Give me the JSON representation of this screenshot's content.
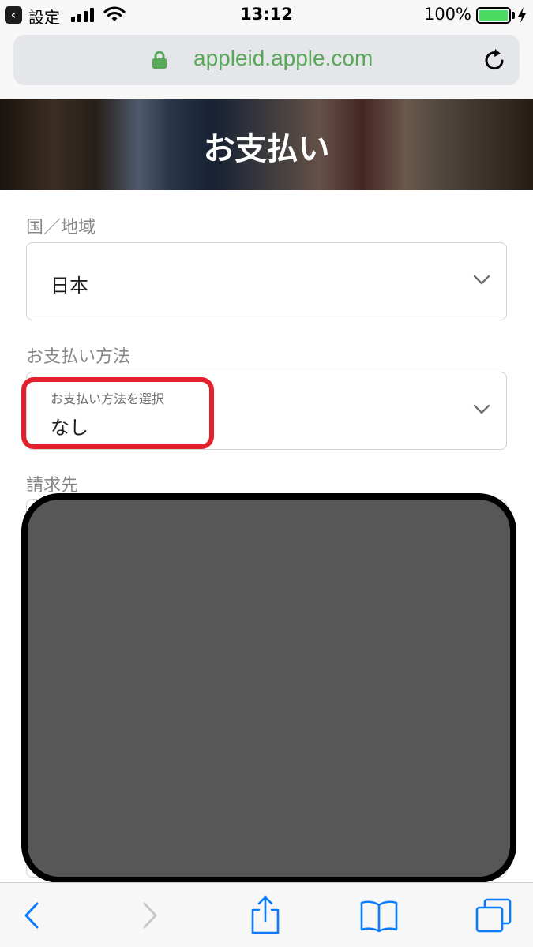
{
  "status_bar": {
    "back_label": "設定",
    "time": "13:12",
    "battery_percent": "100%",
    "battery_level": 1.0
  },
  "browser": {
    "url": "appleid.apple.com"
  },
  "page": {
    "title": "お支払い"
  },
  "form": {
    "country": {
      "label": "国／地域",
      "value": "日本"
    },
    "payment_method": {
      "label": "お支払い方法",
      "select_label": "お支払い方法を選択",
      "value": "なし"
    },
    "billing": {
      "label": "請求先"
    }
  },
  "colors": {
    "url_green": "#58a85a",
    "highlight_red": "#e4202c",
    "battery_green": "#4cd964",
    "toolbar_blue": "#0a7aff",
    "redaction_gray": "#575757"
  },
  "toolbar": {
    "icons": [
      "back-icon",
      "forward-icon",
      "share-icon",
      "bookmarks-icon",
      "tabs-icon"
    ]
  }
}
